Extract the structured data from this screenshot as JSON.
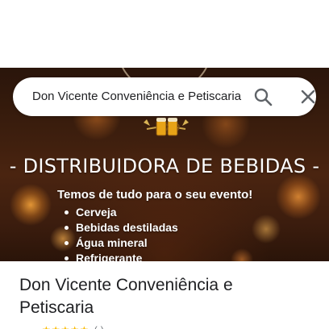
{
  "search": {
    "query": "Don Vicente Conveniência e Petiscaria"
  },
  "hero": {
    "title": "- DISTRIBUIDORA DE BEBIDAS -",
    "subtitle": "Temos de tudo para o seu evento!",
    "items": [
      "Cerveja",
      "Bebidas destiladas",
      "Água mineral",
      "Refrigerante"
    ]
  },
  "place": {
    "name": "Don Vicente Conveniência e Petiscaria",
    "stars": "★★★★★",
    "reviews": "(·)"
  },
  "icons": {
    "search": "search-icon",
    "close": "close-icon",
    "beer": "beer-mugs-icon"
  },
  "colors": {
    "icon_gray": "#5f6368",
    "text": "#202124",
    "star": "#fbbc04",
    "hero_text": "#ffffff"
  }
}
